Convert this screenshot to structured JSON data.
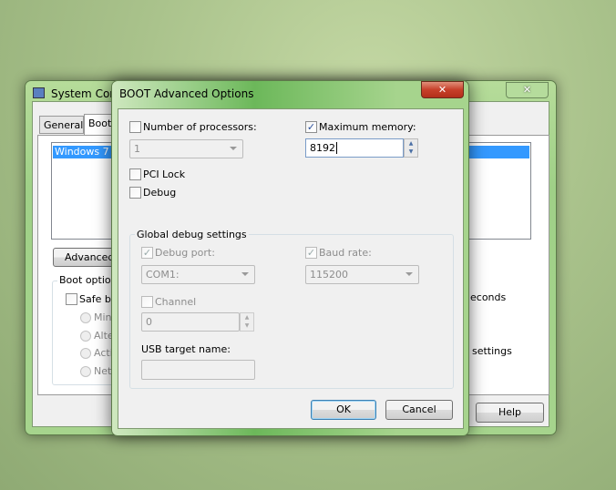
{
  "back_window": {
    "title": "System Configuration",
    "tabs": [
      "General",
      "Boot"
    ],
    "os_entry": "Windows 7 (C",
    "advanced_button": "Advanced o",
    "boot_options_legend": "Boot options",
    "safe_boot": "Safe bo",
    "radios": [
      "Minim",
      "Alter",
      "Activ",
      "Netw"
    ],
    "timeout_suffix": "econds",
    "settings_suffix": "settings",
    "help_button": "Help"
  },
  "dialog": {
    "title": "BOOT Advanced Options",
    "num_processors": {
      "label": "Number of processors:",
      "checked": false,
      "value": "1"
    },
    "max_memory": {
      "label": "Maximum memory:",
      "checked": true,
      "value": "8192"
    },
    "pci_lock": {
      "label": "PCI Lock",
      "checked": false
    },
    "debug": {
      "label": "Debug",
      "checked": false
    },
    "global_debug": {
      "legend": "Global debug settings",
      "debug_port": {
        "label": "Debug port:",
        "checked": true,
        "value": "COM1:"
      },
      "baud_rate": {
        "label": "Baud rate:",
        "checked": true,
        "value": "115200"
      },
      "channel": {
        "label": "Channel",
        "checked": false,
        "value": "0"
      },
      "usb_target": {
        "label": "USB target name:",
        "value": ""
      }
    },
    "ok": "OK",
    "cancel": "Cancel",
    "check_glyph": "✓",
    "close_glyph": "✕"
  },
  "colors": {
    "selection": "#3399ff",
    "close_red": "#c7402a",
    "frame_green": "#a6d48d"
  }
}
